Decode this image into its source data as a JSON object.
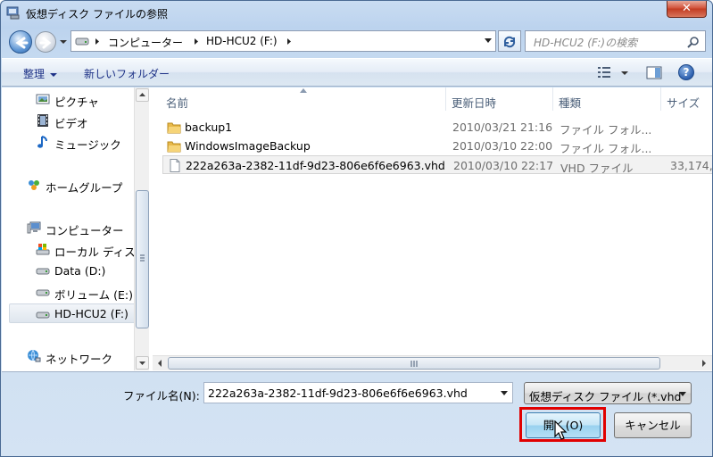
{
  "window": {
    "title": "仮想ディスク ファイルの参照",
    "close_label": "✕"
  },
  "address": {
    "crumbs": [
      "コンピューター",
      "HD-HCU2 (F:)"
    ]
  },
  "search": {
    "placeholder": "HD-HCU2 (F:)の検索"
  },
  "toolbar": {
    "organize_label": "整理",
    "new_folder_label": "新しいフォルダー",
    "help_label": "?"
  },
  "nav_pane": {
    "items": [
      {
        "label": "ピクチャ",
        "icon": "pictures-icon",
        "selected": false
      },
      {
        "label": "ビデオ",
        "icon": "video-icon",
        "selected": false
      },
      {
        "label": "ミュージック",
        "icon": "music-icon",
        "selected": false
      },
      {
        "label": "ホームグループ",
        "icon": "homegroup-icon",
        "selected": false
      },
      {
        "label": "コンピューター",
        "icon": "computer-icon",
        "selected": false
      },
      {
        "label": "ローカル ディスク",
        "icon": "local-disk-icon",
        "selected": false
      },
      {
        "label": "Data (D:)",
        "icon": "drive-icon",
        "selected": false
      },
      {
        "label": "ボリューム (E:)",
        "icon": "drive-icon",
        "selected": false
      },
      {
        "label": "HD-HCU2 (F:)",
        "icon": "drive-icon",
        "selected": true
      },
      {
        "label": "ネットワーク",
        "icon": "network-icon",
        "selected": false
      }
    ]
  },
  "file_list": {
    "columns": [
      "名前",
      "更新日時",
      "種類",
      "サイズ"
    ],
    "rows": [
      {
        "name": "backup1",
        "date": "2010/03/21 21:16",
        "type": "ファイル フォル...",
        "size": "",
        "icon": "folder-icon",
        "selected": false
      },
      {
        "name": "WindowsImageBackup",
        "date": "2010/03/10 22:00",
        "type": "ファイル フォル...",
        "size": "",
        "icon": "folder-icon",
        "selected": false
      },
      {
        "name": "222a263a-2382-11df-9d23-806e6f6e6963.vhd",
        "date": "2010/03/10 22:17",
        "type": "VHD ファイル",
        "size": "33,174,",
        "icon": "file-icon",
        "selected": true
      }
    ]
  },
  "bottom": {
    "filename_label": "ファイル名(N):",
    "filename_value": "222a263a-2382-11df-9d23-806e6f6e6963.vhd",
    "filetype_value": "仮想ディスク ファイル (*.vhd",
    "open_label": "開く(O)",
    "cancel_label": "キャンセル"
  },
  "colors": {
    "highlight": "#e10000",
    "link_text": "#1e3287"
  }
}
